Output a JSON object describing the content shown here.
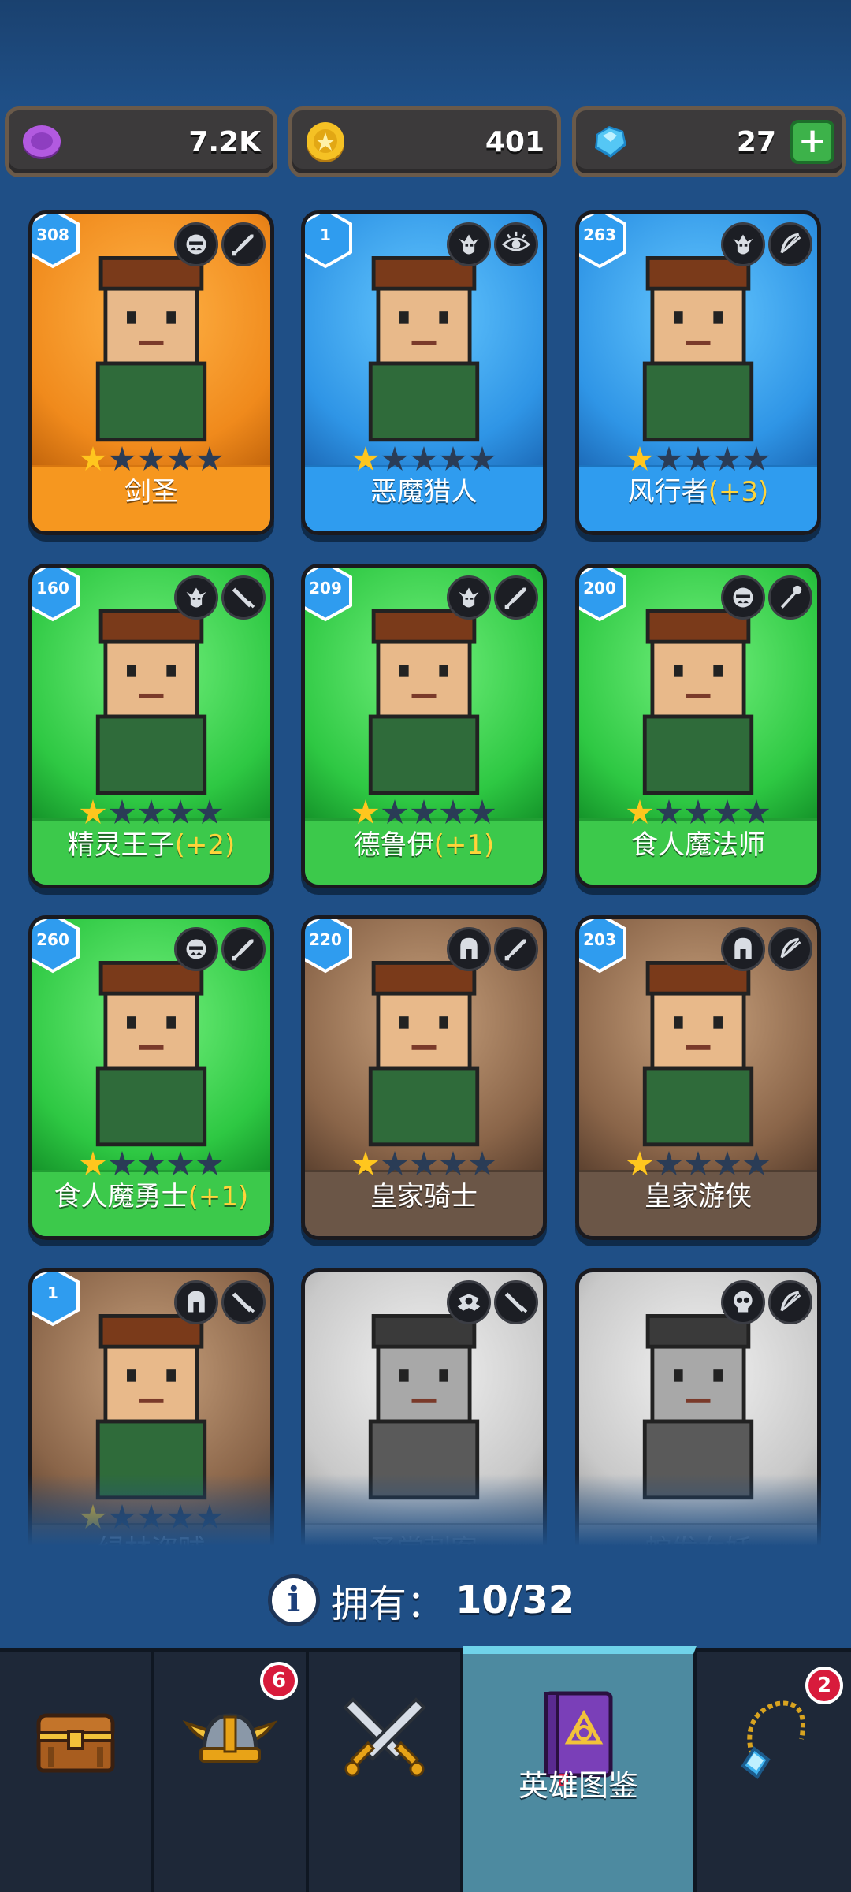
{
  "currencies": [
    {
      "name": "purple-gem",
      "value": "7.2K",
      "color": "#a64bd6"
    },
    {
      "name": "gold-coin",
      "value": "401",
      "color": "#f2b91d"
    },
    {
      "name": "diamond",
      "value": "27",
      "color": "#3fb3f0"
    }
  ],
  "heroes": [
    {
      "name": "剑圣",
      "bonus": "",
      "level": "308",
      "rarity": "orange",
      "stars": 1,
      "role1": "orc-face-icon",
      "role2": "sword-icon"
    },
    {
      "name": "恶魔猎人",
      "bonus": "",
      "level": "1",
      "rarity": "blue",
      "stars": 1,
      "role1": "elf-face-icon",
      "role2": "eye-icon"
    },
    {
      "name": "风行者",
      "bonus": "(+3)",
      "level": "263",
      "rarity": "blue",
      "stars": 1,
      "role1": "elf-face-icon",
      "role2": "bow-icon"
    },
    {
      "name": "精灵王子",
      "bonus": "(+2)",
      "level": "160",
      "rarity": "green",
      "stars": 1,
      "role1": "elf-face-icon",
      "role2": "dagger-icon"
    },
    {
      "name": "德鲁伊",
      "bonus": "(+1)",
      "level": "209",
      "rarity": "green",
      "stars": 1,
      "role1": "elf-face-icon",
      "role2": "sword-icon"
    },
    {
      "name": "食人魔法师",
      "bonus": "",
      "level": "200",
      "rarity": "green",
      "stars": 1,
      "role1": "orc-face-icon",
      "role2": "staff-icon"
    },
    {
      "name": "食人魔勇士",
      "bonus": "(+1)",
      "level": "260",
      "rarity": "green",
      "stars": 1,
      "role1": "orc-face-icon",
      "role2": "sword-icon"
    },
    {
      "name": "皇家骑士",
      "bonus": "",
      "level": "220",
      "rarity": "brown",
      "stars": 1,
      "role1": "helmet-icon",
      "role2": "sword-icon"
    },
    {
      "name": "皇家游侠",
      "bonus": "",
      "level": "203",
      "rarity": "brown",
      "stars": 1,
      "role1": "helmet-icon",
      "role2": "bow-icon"
    },
    {
      "name": "绿林盗贼",
      "bonus": "",
      "level": "1",
      "rarity": "brown",
      "stars": 1,
      "role1": "helmet-icon",
      "role2": "dagger-icon"
    },
    {
      "name": "圣堂刺客",
      "bonus": "",
      "level": "",
      "rarity": "gray",
      "stars": 0,
      "role1": "winged-icon",
      "role2": "dagger-icon"
    },
    {
      "name": "蛇发女妖",
      "bonus": "",
      "level": "",
      "rarity": "gray",
      "stars": 0,
      "role1": "skull-icon",
      "role2": "bow-icon"
    }
  ],
  "owned": {
    "label": "拥有：",
    "value": "10/32"
  },
  "nav": [
    {
      "name": "chest-icon",
      "label": "",
      "badge": ""
    },
    {
      "name": "viking-helmet-icon",
      "label": "",
      "badge": "6"
    },
    {
      "name": "crossed-swords-icon",
      "label": "",
      "badge": ""
    },
    {
      "name": "hero-book-icon",
      "label": "英雄图鉴",
      "badge": "",
      "active": true
    },
    {
      "name": "amulet-icon",
      "label": "",
      "badge": "2"
    }
  ]
}
